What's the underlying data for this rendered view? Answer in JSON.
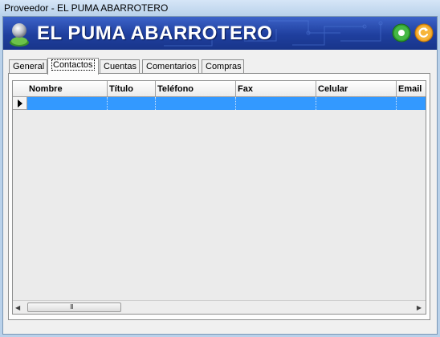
{
  "window": {
    "title": "Proveedor - EL PUMA ABARROTERO"
  },
  "banner": {
    "title": "EL PUMA ABARROTERO",
    "green_button_icon": "record-icon",
    "orange_button_icon": "refresh-icon",
    "colors": {
      "background": "#1f3f9e",
      "green": "#2e9e2e",
      "orange": "#f0a020"
    }
  },
  "tabs": [
    {
      "label": "General"
    },
    {
      "label": "Contactos",
      "active": true
    },
    {
      "label": "Cuentas"
    },
    {
      "label": "Comentarios"
    },
    {
      "label": "Compras"
    }
  ],
  "grid": {
    "columns": [
      "Nombre",
      "Título",
      "Teléfono",
      "Fax",
      "Celular",
      "Email"
    ],
    "rows": [
      [
        "",
        "",
        "",
        "",
        "",
        ""
      ]
    ],
    "selection_color": "#3399ff",
    "hscroll_grip": "III"
  }
}
